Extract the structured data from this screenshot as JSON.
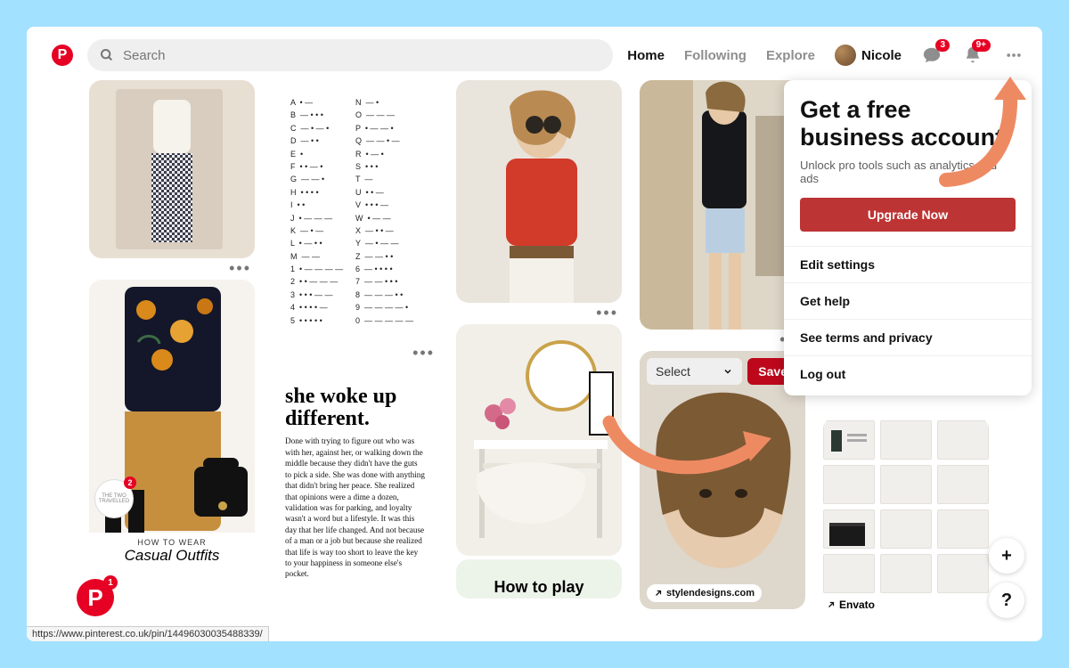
{
  "header": {
    "search_placeholder": "Search",
    "nav": {
      "home": "Home",
      "following": "Following",
      "explore": "Explore"
    },
    "username": "Nicole",
    "chat_badge": "3",
    "bell_badge": "9+"
  },
  "menu": {
    "title": "Get a free business account",
    "subtitle": "Unlock pro tools such as analytics and ads",
    "cta": "Upgrade Now",
    "items": [
      "Edit settings",
      "Get help",
      "See terms and privacy",
      "Log out"
    ]
  },
  "hover_pin": {
    "select_label": "Select",
    "save_label": "Save",
    "link_text": "stylendesigns.com"
  },
  "pins": {
    "casual": {
      "line1": "HOW TO WEAR",
      "line2": "Casual Outfits"
    },
    "text_quote": {
      "heading": "she woke up different.",
      "body": "Done with trying to figure out who was with her, against her, or walking down the middle because they didn't have the guts to pick a side. She was done with anything that didn't bring her peace. She realized that opinions were a dime a dozen, validation was for parking, and loyalty wasn't a word but a lifestyle. It was this day that her life changed. And not because of a man or a job but because she realized that life is way too short to leave the key to your happiness in someone else's pocket."
    },
    "howto": "How to play",
    "envato_label": "Envato",
    "morse": [
      [
        "A  • —",
        "N  — •"
      ],
      [
        "B  — • • •",
        "O  — — —"
      ],
      [
        "C  — • — •",
        "P  • — — •"
      ],
      [
        "D  — • •",
        "Q  — — • —"
      ],
      [
        "E  •",
        "R  • — •"
      ],
      [
        "F  • • — •",
        "S  • • •"
      ],
      [
        "G  — — •",
        "T  —"
      ],
      [
        "H  • • • •",
        "U  • • —"
      ],
      [
        "I  • •",
        "V  • • • —"
      ],
      [
        "J  • — — —",
        "W  • — —"
      ],
      [
        "K  — • —",
        "X  — • • —"
      ],
      [
        "L  • — • •",
        "Y  — • — —"
      ],
      [
        "M  — —",
        "Z  — — • •"
      ],
      [
        "1  • — — — —",
        "6  — • • • •"
      ],
      [
        "2  • • — — —",
        "7  — — • • •"
      ],
      [
        "3  • • • — —",
        "8  — — — • •"
      ],
      [
        "4  • • • • —",
        "9  — — — — •"
      ],
      [
        "5  • • • • •",
        "0  — — — — —"
      ]
    ],
    "travelled_badge": "2"
  },
  "status_url": "https://www.pinterest.co.uk/pin/14496030035488339/",
  "float_badge": "1"
}
